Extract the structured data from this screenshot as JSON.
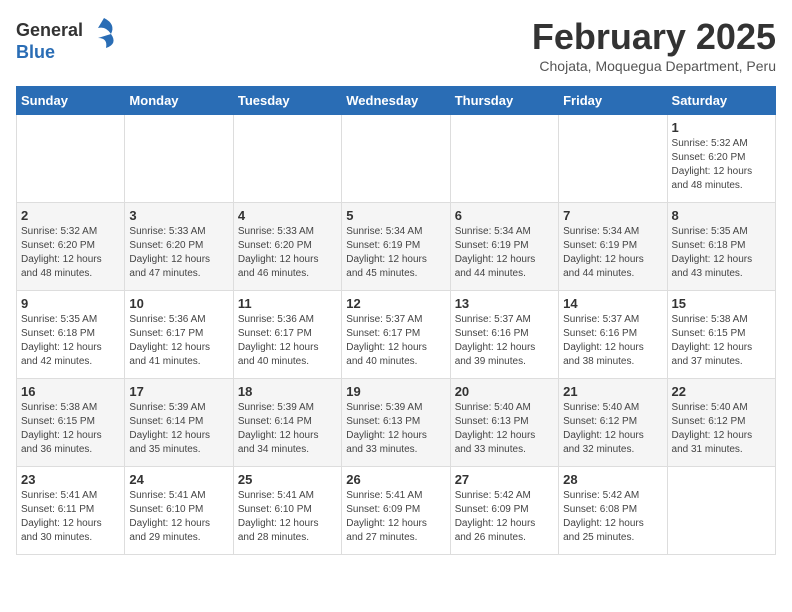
{
  "header": {
    "logo_general": "General",
    "logo_blue": "Blue",
    "title": "February 2025",
    "subtitle": "Chojata, Moquegua Department, Peru"
  },
  "weekdays": [
    "Sunday",
    "Monday",
    "Tuesday",
    "Wednesday",
    "Thursday",
    "Friday",
    "Saturday"
  ],
  "weeks": [
    [
      {
        "day": "",
        "info": ""
      },
      {
        "day": "",
        "info": ""
      },
      {
        "day": "",
        "info": ""
      },
      {
        "day": "",
        "info": ""
      },
      {
        "day": "",
        "info": ""
      },
      {
        "day": "",
        "info": ""
      },
      {
        "day": "1",
        "info": "Sunrise: 5:32 AM\nSunset: 6:20 PM\nDaylight: 12 hours and 48 minutes."
      }
    ],
    [
      {
        "day": "2",
        "info": "Sunrise: 5:32 AM\nSunset: 6:20 PM\nDaylight: 12 hours and 48 minutes."
      },
      {
        "day": "3",
        "info": "Sunrise: 5:33 AM\nSunset: 6:20 PM\nDaylight: 12 hours and 47 minutes."
      },
      {
        "day": "4",
        "info": "Sunrise: 5:33 AM\nSunset: 6:20 PM\nDaylight: 12 hours and 46 minutes."
      },
      {
        "day": "5",
        "info": "Sunrise: 5:34 AM\nSunset: 6:19 PM\nDaylight: 12 hours and 45 minutes."
      },
      {
        "day": "6",
        "info": "Sunrise: 5:34 AM\nSunset: 6:19 PM\nDaylight: 12 hours and 44 minutes."
      },
      {
        "day": "7",
        "info": "Sunrise: 5:34 AM\nSunset: 6:19 PM\nDaylight: 12 hours and 44 minutes."
      },
      {
        "day": "8",
        "info": "Sunrise: 5:35 AM\nSunset: 6:18 PM\nDaylight: 12 hours and 43 minutes."
      }
    ],
    [
      {
        "day": "9",
        "info": "Sunrise: 5:35 AM\nSunset: 6:18 PM\nDaylight: 12 hours and 42 minutes."
      },
      {
        "day": "10",
        "info": "Sunrise: 5:36 AM\nSunset: 6:17 PM\nDaylight: 12 hours and 41 minutes."
      },
      {
        "day": "11",
        "info": "Sunrise: 5:36 AM\nSunset: 6:17 PM\nDaylight: 12 hours and 40 minutes."
      },
      {
        "day": "12",
        "info": "Sunrise: 5:37 AM\nSunset: 6:17 PM\nDaylight: 12 hours and 40 minutes."
      },
      {
        "day": "13",
        "info": "Sunrise: 5:37 AM\nSunset: 6:16 PM\nDaylight: 12 hours and 39 minutes."
      },
      {
        "day": "14",
        "info": "Sunrise: 5:37 AM\nSunset: 6:16 PM\nDaylight: 12 hours and 38 minutes."
      },
      {
        "day": "15",
        "info": "Sunrise: 5:38 AM\nSunset: 6:15 PM\nDaylight: 12 hours and 37 minutes."
      }
    ],
    [
      {
        "day": "16",
        "info": "Sunrise: 5:38 AM\nSunset: 6:15 PM\nDaylight: 12 hours and 36 minutes."
      },
      {
        "day": "17",
        "info": "Sunrise: 5:39 AM\nSunset: 6:14 PM\nDaylight: 12 hours and 35 minutes."
      },
      {
        "day": "18",
        "info": "Sunrise: 5:39 AM\nSunset: 6:14 PM\nDaylight: 12 hours and 34 minutes."
      },
      {
        "day": "19",
        "info": "Sunrise: 5:39 AM\nSunset: 6:13 PM\nDaylight: 12 hours and 33 minutes."
      },
      {
        "day": "20",
        "info": "Sunrise: 5:40 AM\nSunset: 6:13 PM\nDaylight: 12 hours and 33 minutes."
      },
      {
        "day": "21",
        "info": "Sunrise: 5:40 AM\nSunset: 6:12 PM\nDaylight: 12 hours and 32 minutes."
      },
      {
        "day": "22",
        "info": "Sunrise: 5:40 AM\nSunset: 6:12 PM\nDaylight: 12 hours and 31 minutes."
      }
    ],
    [
      {
        "day": "23",
        "info": "Sunrise: 5:41 AM\nSunset: 6:11 PM\nDaylight: 12 hours and 30 minutes."
      },
      {
        "day": "24",
        "info": "Sunrise: 5:41 AM\nSunset: 6:10 PM\nDaylight: 12 hours and 29 minutes."
      },
      {
        "day": "25",
        "info": "Sunrise: 5:41 AM\nSunset: 6:10 PM\nDaylight: 12 hours and 28 minutes."
      },
      {
        "day": "26",
        "info": "Sunrise: 5:41 AM\nSunset: 6:09 PM\nDaylight: 12 hours and 27 minutes."
      },
      {
        "day": "27",
        "info": "Sunrise: 5:42 AM\nSunset: 6:09 PM\nDaylight: 12 hours and 26 minutes."
      },
      {
        "day": "28",
        "info": "Sunrise: 5:42 AM\nSunset: 6:08 PM\nDaylight: 12 hours and 25 minutes."
      },
      {
        "day": "",
        "info": ""
      }
    ]
  ]
}
